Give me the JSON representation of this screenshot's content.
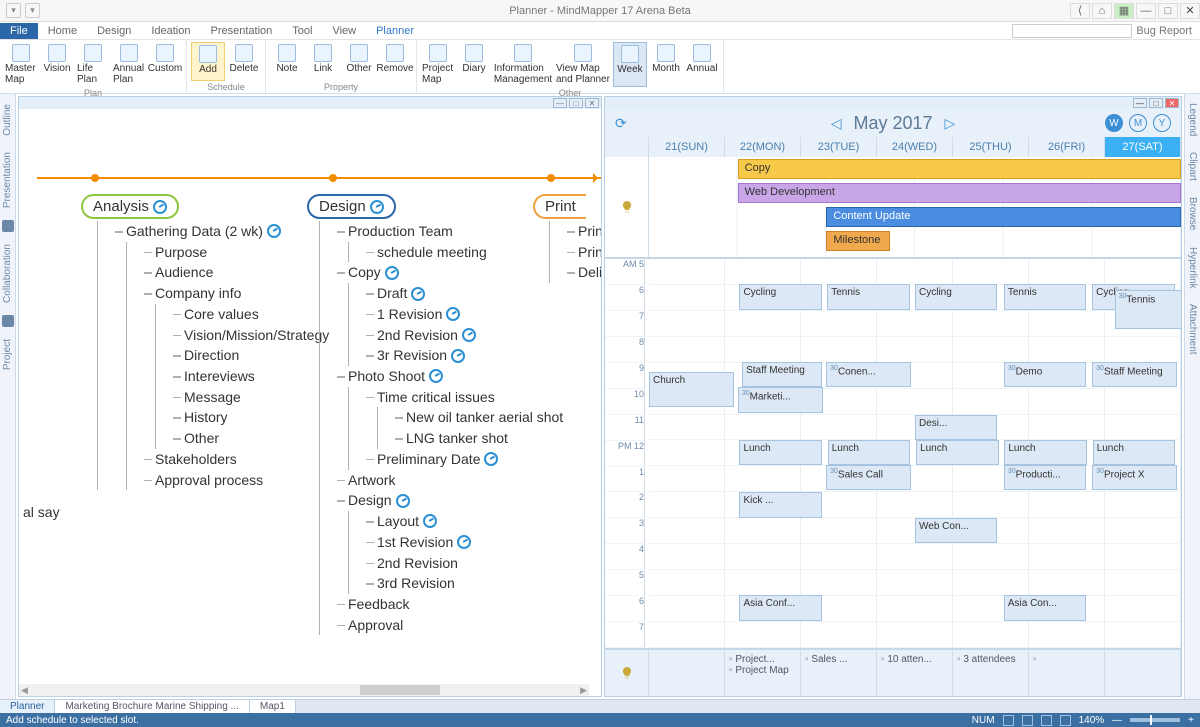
{
  "app": {
    "title": "Planner - MindMapper 17 Arena Beta",
    "bugReport": "Bug Report"
  },
  "menu": {
    "file": "File",
    "home": "Home",
    "design": "Design",
    "ideation": "Ideation",
    "presentation": "Presentation",
    "tool": "Tool",
    "view": "View",
    "planner": "Planner"
  },
  "ribbon": {
    "plan": {
      "master": "Master\nMap",
      "vision": "Vision",
      "life": "Life\nPlan",
      "annual": "Annual\nPlan",
      "custom": "Custom",
      "label": "Plan"
    },
    "schedule": {
      "add": "Add",
      "delete": "Delete",
      "label": "Schedule"
    },
    "property": {
      "note": "Note",
      "link": "Link",
      "other": "Other",
      "remove": "Remove",
      "label": "Property"
    },
    "other": {
      "project": "Project\nMap",
      "diary": "Diary",
      "info": "Information\nManagement",
      "viewmap": "View Map and\nPlanner",
      "week": "Week",
      "month": "Month",
      "annual": "Annual",
      "label": "Other"
    }
  },
  "leftrail": [
    "Outline",
    "Presentation",
    "Collaboration",
    "Project"
  ],
  "rightrail": [
    "Legend",
    "Clipart",
    "Browse",
    "Hyperlink",
    "Attachment"
  ],
  "mind": {
    "analysis": "Analysis",
    "design": "Design",
    "print": "Print",
    "iso": "al say",
    "analysisTree": {
      "gathering": "Gathering Data (2 wk)",
      "purpose": "Purpose",
      "audience": "Audience",
      "company": "Company info",
      "core": "Core values",
      "vms": "Vision/Mission/Strategy",
      "direction": "Direction",
      "interviews": "Intereviews",
      "message": "Message",
      "history": "History",
      "other": "Other",
      "stakeholders": "Stakeholders",
      "approval": "Approval process"
    },
    "designTree": {
      "prod": "Production Team",
      "sched": "schedule meeting",
      "copy": "Copy",
      "draft": "Draft",
      "rev1": "1 Revision",
      "rev2": "2nd Revision",
      "rev3": "3r Revision",
      "photo": "Photo Shoot",
      "time": "Time critical issues",
      "oil": "New oil tanker aerial shot",
      "lng": "LNG tanker shot",
      "prelim": "Preliminary Date",
      "artwork": "Artwork",
      "design2": "Design",
      "layout": "Layout",
      "rev1b": "1st Revision",
      "rev2b": "2nd Revision",
      "rev3b": "3rd Revision",
      "feedback": "Feedback",
      "approval": "Approval"
    },
    "printTree": {
      "p1": "Print",
      "p2": "Print",
      "p3": "Deliv"
    }
  },
  "cal": {
    "month": "May  2017",
    "views": {
      "w": "W",
      "m": "M",
      "y": "Y"
    },
    "days": [
      "21(SUN)",
      "22(MON)",
      "23(TUE)",
      "24(WED)",
      "25(THU)",
      "26(FRI)",
      "27(SAT)"
    ],
    "hours": [
      "AM 5",
      "6",
      "7",
      "8",
      "9",
      "10",
      "11",
      "PM 12",
      "1",
      "2",
      "3",
      "4",
      "5",
      "6",
      "7"
    ],
    "allday": {
      "copy": "Copy",
      "web": "Web Development",
      "content": "Content Update",
      "milestone": "Milestone ..."
    },
    "events": {
      "cycling": "Cycling",
      "tennis": "Tennis",
      "staff": "Staff Meeting",
      "conen": "Conen...",
      "marketi": "Marketi...",
      "church": "Church",
      "demo": "Demo",
      "desi": "Desi...",
      "lunch": "Lunch",
      "sales": "Sales Call",
      "kick": "Kick ...",
      "producti": "Producti...",
      "projectx": "Project X",
      "webcon": "Web Con...",
      "asia": "Asia Conf...",
      "asiacon": "Asia Con..."
    },
    "bottom": {
      "project": "Project...",
      "projectmap": "Project Map",
      "sales": "Sales ...",
      "attendees10": "10 atten...",
      "attendees3": "3 attendees"
    }
  },
  "tabs": {
    "planner": "Planner",
    "marketing": "Marketing Brochure Marine Shipping ...",
    "map1": "Map1"
  },
  "status": {
    "msg": "Add schedule to selected slot.",
    "num": "NUM",
    "zoom": "140%"
  }
}
